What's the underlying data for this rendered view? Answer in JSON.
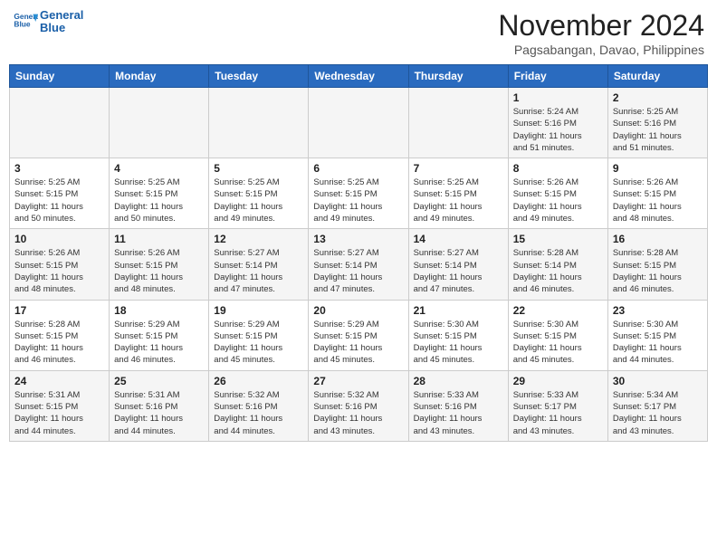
{
  "header": {
    "logo_line1": "General",
    "logo_line2": "Blue",
    "month_year": "November 2024",
    "location": "Pagsabangan, Davao, Philippines"
  },
  "calendar": {
    "days_of_week": [
      "Sunday",
      "Monday",
      "Tuesday",
      "Wednesday",
      "Thursday",
      "Friday",
      "Saturday"
    ],
    "weeks": [
      [
        {
          "day": "",
          "info": ""
        },
        {
          "day": "",
          "info": ""
        },
        {
          "day": "",
          "info": ""
        },
        {
          "day": "",
          "info": ""
        },
        {
          "day": "",
          "info": ""
        },
        {
          "day": "1",
          "info": "Sunrise: 5:24 AM\nSunset: 5:16 PM\nDaylight: 11 hours\nand 51 minutes."
        },
        {
          "day": "2",
          "info": "Sunrise: 5:25 AM\nSunset: 5:16 PM\nDaylight: 11 hours\nand 51 minutes."
        }
      ],
      [
        {
          "day": "3",
          "info": "Sunrise: 5:25 AM\nSunset: 5:15 PM\nDaylight: 11 hours\nand 50 minutes."
        },
        {
          "day": "4",
          "info": "Sunrise: 5:25 AM\nSunset: 5:15 PM\nDaylight: 11 hours\nand 50 minutes."
        },
        {
          "day": "5",
          "info": "Sunrise: 5:25 AM\nSunset: 5:15 PM\nDaylight: 11 hours\nand 49 minutes."
        },
        {
          "day": "6",
          "info": "Sunrise: 5:25 AM\nSunset: 5:15 PM\nDaylight: 11 hours\nand 49 minutes."
        },
        {
          "day": "7",
          "info": "Sunrise: 5:25 AM\nSunset: 5:15 PM\nDaylight: 11 hours\nand 49 minutes."
        },
        {
          "day": "8",
          "info": "Sunrise: 5:26 AM\nSunset: 5:15 PM\nDaylight: 11 hours\nand 49 minutes."
        },
        {
          "day": "9",
          "info": "Sunrise: 5:26 AM\nSunset: 5:15 PM\nDaylight: 11 hours\nand 48 minutes."
        }
      ],
      [
        {
          "day": "10",
          "info": "Sunrise: 5:26 AM\nSunset: 5:15 PM\nDaylight: 11 hours\nand 48 minutes."
        },
        {
          "day": "11",
          "info": "Sunrise: 5:26 AM\nSunset: 5:15 PM\nDaylight: 11 hours\nand 48 minutes."
        },
        {
          "day": "12",
          "info": "Sunrise: 5:27 AM\nSunset: 5:14 PM\nDaylight: 11 hours\nand 47 minutes."
        },
        {
          "day": "13",
          "info": "Sunrise: 5:27 AM\nSunset: 5:14 PM\nDaylight: 11 hours\nand 47 minutes."
        },
        {
          "day": "14",
          "info": "Sunrise: 5:27 AM\nSunset: 5:14 PM\nDaylight: 11 hours\nand 47 minutes."
        },
        {
          "day": "15",
          "info": "Sunrise: 5:28 AM\nSunset: 5:14 PM\nDaylight: 11 hours\nand 46 minutes."
        },
        {
          "day": "16",
          "info": "Sunrise: 5:28 AM\nSunset: 5:15 PM\nDaylight: 11 hours\nand 46 minutes."
        }
      ],
      [
        {
          "day": "17",
          "info": "Sunrise: 5:28 AM\nSunset: 5:15 PM\nDaylight: 11 hours\nand 46 minutes."
        },
        {
          "day": "18",
          "info": "Sunrise: 5:29 AM\nSunset: 5:15 PM\nDaylight: 11 hours\nand 46 minutes."
        },
        {
          "day": "19",
          "info": "Sunrise: 5:29 AM\nSunset: 5:15 PM\nDaylight: 11 hours\nand 45 minutes."
        },
        {
          "day": "20",
          "info": "Sunrise: 5:29 AM\nSunset: 5:15 PM\nDaylight: 11 hours\nand 45 minutes."
        },
        {
          "day": "21",
          "info": "Sunrise: 5:30 AM\nSunset: 5:15 PM\nDaylight: 11 hours\nand 45 minutes."
        },
        {
          "day": "22",
          "info": "Sunrise: 5:30 AM\nSunset: 5:15 PM\nDaylight: 11 hours\nand 45 minutes."
        },
        {
          "day": "23",
          "info": "Sunrise: 5:30 AM\nSunset: 5:15 PM\nDaylight: 11 hours\nand 44 minutes."
        }
      ],
      [
        {
          "day": "24",
          "info": "Sunrise: 5:31 AM\nSunset: 5:15 PM\nDaylight: 11 hours\nand 44 minutes."
        },
        {
          "day": "25",
          "info": "Sunrise: 5:31 AM\nSunset: 5:16 PM\nDaylight: 11 hours\nand 44 minutes."
        },
        {
          "day": "26",
          "info": "Sunrise: 5:32 AM\nSunset: 5:16 PM\nDaylight: 11 hours\nand 44 minutes."
        },
        {
          "day": "27",
          "info": "Sunrise: 5:32 AM\nSunset: 5:16 PM\nDaylight: 11 hours\nand 43 minutes."
        },
        {
          "day": "28",
          "info": "Sunrise: 5:33 AM\nSunset: 5:16 PM\nDaylight: 11 hours\nand 43 minutes."
        },
        {
          "day": "29",
          "info": "Sunrise: 5:33 AM\nSunset: 5:17 PM\nDaylight: 11 hours\nand 43 minutes."
        },
        {
          "day": "30",
          "info": "Sunrise: 5:34 AM\nSunset: 5:17 PM\nDaylight: 11 hours\nand 43 minutes."
        }
      ]
    ]
  }
}
